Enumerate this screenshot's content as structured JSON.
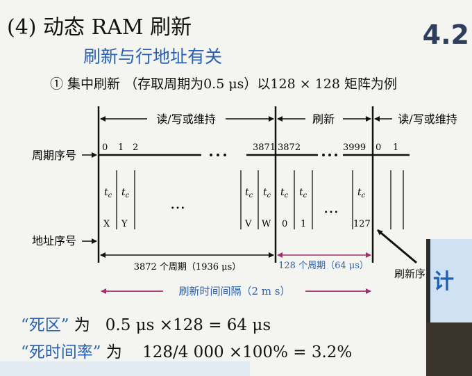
{
  "title": "(4)  动态 RAM 刷新",
  "subtitle": "刷新与行地址有关",
  "section_number": "4.2",
  "item": "① 集中刷新 （存取周期为0.5 μs）以128 × 128 矩阵为例",
  "diagram": {
    "phase_rw_left": "读/写或维持",
    "phase_refresh": "刷新",
    "phase_rw_right": "读/写或维持",
    "row_cycle_label": "周期序号",
    "row_address_label": "地址序号",
    "cycle_numbers": [
      "0",
      "1",
      "2",
      "3871",
      "3872",
      "3999",
      "0",
      "1"
    ],
    "tc_label": "t",
    "tc_sub": "c",
    "ellipsis": "…",
    "address_labels": [
      "X",
      "Y",
      "V",
      "W",
      "0",
      "1",
      "127"
    ],
    "span_rw": "3872 个周期（1936 μs）",
    "span_refresh": "128 个周期（64 μs）",
    "span_total": "刷新时间间隔（2 m s）",
    "callout": "刷新序",
    "colors": {
      "blue": "#2a62b3",
      "magenta": "#a0306a"
    }
  },
  "dead_zone": {
    "q1": "“死区”",
    "mid": " 为   ",
    "expr": "0.5 μs ×128 = 64 μs"
  },
  "dead_rate": {
    "q1": "“死时间率”",
    "mid": " 为    ",
    "expr": "128/4 000 ×100% = 3.2%"
  },
  "video_overlay_text": "计"
}
